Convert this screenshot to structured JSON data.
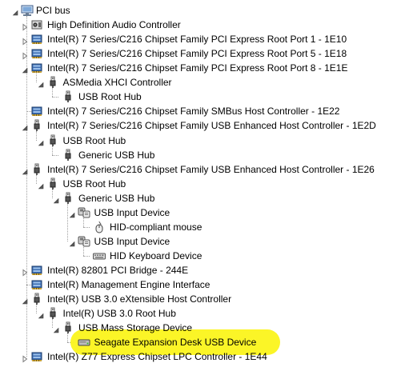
{
  "device_tree": {
    "items": [
      {
        "label": "PCI bus",
        "depth": 0,
        "icon": "computer-icon",
        "expander": "collapse"
      },
      {
        "label": "High Definition Audio Controller",
        "depth": 1,
        "icon": "sound-card-icon",
        "expander": "expand"
      },
      {
        "label": "Intel(R) 7 Series/C216 Chipset Family PCI Express Root Port 1 - 1E10",
        "depth": 1,
        "icon": "pci-bridge-icon",
        "expander": "expand"
      },
      {
        "label": "Intel(R) 7 Series/C216 Chipset Family PCI Express Root Port 5 - 1E18",
        "depth": 1,
        "icon": "pci-bridge-icon",
        "expander": "expand"
      },
      {
        "label": "Intel(R) 7 Series/C216 Chipset Family PCI Express Root Port 8 - 1E1E",
        "depth": 1,
        "icon": "pci-bridge-icon",
        "expander": "collapse"
      },
      {
        "label": "ASMedia XHCI Controller",
        "depth": 2,
        "icon": "usb-plug-icon",
        "expander": "collapse"
      },
      {
        "label": "USB Root Hub",
        "depth": 3,
        "icon": "usb-plug-icon",
        "expander": "none"
      },
      {
        "label": "Intel(R) 7 Series/C216 Chipset Family SMBus Host Controller - 1E22",
        "depth": 1,
        "icon": "pci-bridge-icon",
        "expander": "none"
      },
      {
        "label": "Intel(R) 7 Series/C216 Chipset Family USB Enhanced Host Controller - 1E2D",
        "depth": 1,
        "icon": "usb-plug-icon",
        "expander": "collapse"
      },
      {
        "label": "USB Root Hub",
        "depth": 2,
        "icon": "usb-plug-icon",
        "expander": "collapse"
      },
      {
        "label": "Generic USB Hub",
        "depth": 3,
        "icon": "usb-plug-icon",
        "expander": "none"
      },
      {
        "label": "Intel(R) 7 Series/C216 Chipset Family USB Enhanced Host Controller - 1E26",
        "depth": 1,
        "icon": "usb-plug-icon",
        "expander": "collapse"
      },
      {
        "label": "USB Root Hub",
        "depth": 2,
        "icon": "usb-plug-icon",
        "expander": "collapse"
      },
      {
        "label": "Generic USB Hub",
        "depth": 3,
        "icon": "usb-plug-icon",
        "expander": "collapse"
      },
      {
        "label": "USB Input Device",
        "depth": 4,
        "icon": "hid-icon",
        "expander": "collapse"
      },
      {
        "label": "HID-compliant mouse",
        "depth": 5,
        "icon": "mouse-icon",
        "expander": "none"
      },
      {
        "label": "USB Input Device",
        "depth": 4,
        "icon": "hid-icon",
        "expander": "collapse"
      },
      {
        "label": "HID Keyboard Device",
        "depth": 5,
        "icon": "keyboard-icon",
        "expander": "none"
      },
      {
        "label": "Intel(R) 82801 PCI Bridge - 244E",
        "depth": 1,
        "icon": "pci-bridge-icon",
        "expander": "expand"
      },
      {
        "label": "Intel(R) Management Engine Interface",
        "depth": 1,
        "icon": "pci-bridge-icon",
        "expander": "none"
      },
      {
        "label": "Intel(R) USB 3.0 eXtensible Host Controller",
        "depth": 1,
        "icon": "usb-plug-icon",
        "expander": "collapse"
      },
      {
        "label": "Intel(R) USB 3.0 Root Hub",
        "depth": 2,
        "icon": "usb-plug-icon",
        "expander": "collapse"
      },
      {
        "label": "USB Mass Storage Device",
        "depth": 3,
        "icon": "usb-plug-icon",
        "expander": "collapse"
      },
      {
        "label": "Seagate Expansion Desk USB Device",
        "depth": 4,
        "icon": "disk-drive-icon",
        "expander": "none",
        "highlighted": true
      },
      {
        "label": "Intel(R) Z77 Express Chipset LPC Controller - 1E44",
        "depth": 1,
        "icon": "pci-bridge-icon",
        "expander": "expand"
      }
    ]
  },
  "colors": {
    "highlight": "#fbf41b",
    "text": "#000000",
    "expander": "#595959"
  }
}
